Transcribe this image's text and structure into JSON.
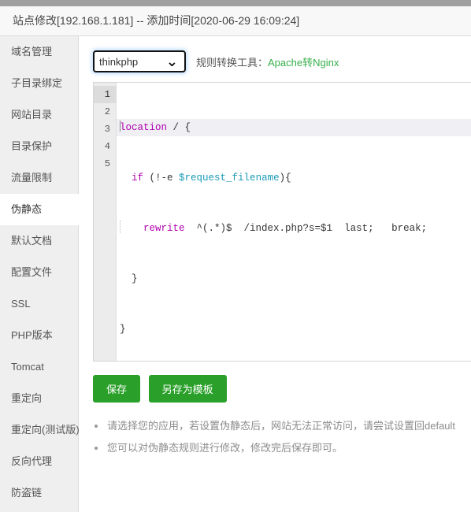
{
  "window": {
    "title": "站点修改[192.168.1.181] -- 添加时间[2020-06-29 16:09:24]"
  },
  "sidebar": {
    "items": [
      {
        "label": "域名管理",
        "active": false
      },
      {
        "label": "子目录绑定",
        "active": false
      },
      {
        "label": "网站目录",
        "active": false
      },
      {
        "label": "目录保护",
        "active": false
      },
      {
        "label": "流量限制",
        "active": false
      },
      {
        "label": "伪静态",
        "active": true
      },
      {
        "label": "默认文档",
        "active": false
      },
      {
        "label": "配置文件",
        "active": false
      },
      {
        "label": "SSL",
        "active": false
      },
      {
        "label": "PHP版本",
        "active": false
      },
      {
        "label": "Tomcat",
        "active": false
      },
      {
        "label": "重定向",
        "active": false
      },
      {
        "label": "重定向(测试版)",
        "active": false
      },
      {
        "label": "反向代理",
        "active": false
      },
      {
        "label": "防盗链",
        "active": false
      }
    ]
  },
  "toolbar": {
    "select_value": "thinkphp",
    "select_options": [
      "thinkphp"
    ],
    "caret_icon": "chevron-down-icon",
    "converter_label": "规则转换工具：",
    "converter_link": "Apache转Nginx",
    "converter_link_color": "#35b04a"
  },
  "editor": {
    "line_numbers": [
      "1",
      "2",
      "3",
      "4",
      "5"
    ],
    "active_line": 1,
    "lines": [
      {
        "n": 1,
        "text": "location / {"
      },
      {
        "n": 2,
        "text": "  if (!-e $request_filename){"
      },
      {
        "n": 3,
        "text": "    rewrite  ^(.*)$  /index.php?s=$1  last;   break;"
      },
      {
        "n": 4,
        "text": "  }"
      },
      {
        "n": 5,
        "text": "}"
      }
    ],
    "tokens": {
      "l1_kw": "location",
      "l1_rest": " / {",
      "l2_indent": "  ",
      "l2_kw": "if",
      "l2_mid": " (!-e ",
      "l2_var": "$request_filename",
      "l2_end": "){",
      "l3_indent": "    ",
      "l3_kw": "rewrite",
      "l3_rest": "  ^(.*)$  /index.php?s=$1  last;   break;",
      "l4_text": "  }",
      "l5_text": "}"
    },
    "colors": {
      "keyword": "#af00af",
      "variable": "#1a9ab5",
      "plain": "#333333",
      "gutter_bg": "#ececec",
      "active_line_bg": "#f0eff4"
    }
  },
  "buttons": {
    "save": "保存",
    "save_as_template": "另存为模板",
    "color": "#2aa02a"
  },
  "notes": [
    "请选择您的应用，若设置伪静态后，网站无法正常访问，请尝试设置回default",
    "您可以对伪静态规则进行修改，修改完后保存即可。"
  ]
}
